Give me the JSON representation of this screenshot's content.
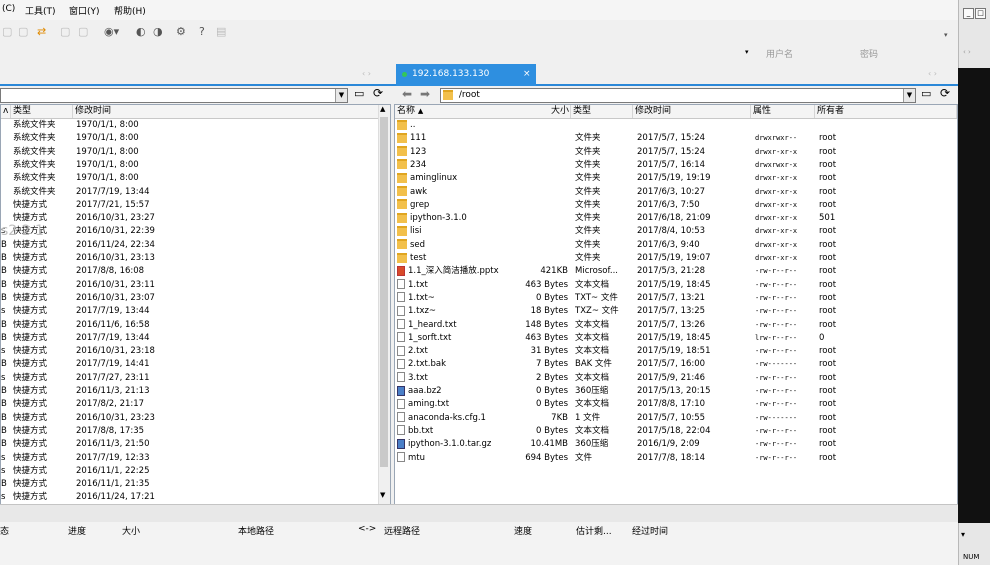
{
  "menu": {
    "items": [
      "(C)",
      "工具(T)",
      "窗口(Y)",
      "帮助(H)"
    ]
  },
  "toolbar": {
    "icons": [
      "new-session-icon",
      "transfer-icon",
      "globe-icon",
      "gear-icon",
      "help-icon"
    ]
  },
  "connect": {
    "username_placeholder": "用户名",
    "password_placeholder": "密码"
  },
  "remote_tab": {
    "title": "192.168.133.130",
    "close": "×",
    "status_color": "#34c759"
  },
  "remote_path": "/root",
  "local_pane": {
    "columns": [
      "类型",
      "修改时间"
    ],
    "rows": [
      {
        "pre": "",
        "type": "系统文件夹",
        "date": "1970/1/1, 8:00"
      },
      {
        "pre": "",
        "type": "系统文件夹",
        "date": "1970/1/1, 8:00"
      },
      {
        "pre": "",
        "type": "系统文件夹",
        "date": "1970/1/1, 8:00"
      },
      {
        "pre": "",
        "type": "系统文件夹",
        "date": "1970/1/1, 8:00"
      },
      {
        "pre": "",
        "type": "系统文件夹",
        "date": "1970/1/1, 8:00"
      },
      {
        "pre": "",
        "type": "系统文件夹",
        "date": "2017/7/19, 13:44"
      },
      {
        "pre": "",
        "type": "快捷方式",
        "date": "2017/7/21, 15:57"
      },
      {
        "pre": "",
        "type": "快捷方式",
        "date": "2016/10/31, 23:27"
      },
      {
        "pre": "s",
        "type": "快捷方式",
        "date": "2016/10/31, 22:39"
      },
      {
        "pre": "B",
        "type": "快捷方式",
        "date": "2016/11/24, 22:34"
      },
      {
        "pre": "B",
        "type": "快捷方式",
        "date": "2016/10/31, 23:13"
      },
      {
        "pre": "B",
        "type": "快捷方式",
        "date": "2017/8/8, 16:08"
      },
      {
        "pre": "B",
        "type": "快捷方式",
        "date": "2016/10/31, 23:11"
      },
      {
        "pre": "B",
        "type": "快捷方式",
        "date": "2016/10/31, 23:07"
      },
      {
        "pre": "s",
        "type": "快捷方式",
        "date": "2017/7/19, 13:44"
      },
      {
        "pre": "B",
        "type": "快捷方式",
        "date": "2016/11/6, 16:58"
      },
      {
        "pre": "B",
        "type": "快捷方式",
        "date": "2017/7/19, 13:44"
      },
      {
        "pre": "s",
        "type": "快捷方式",
        "date": "2016/10/31, 23:18"
      },
      {
        "pre": "B",
        "type": "快捷方式",
        "date": "2017/7/19, 14:41"
      },
      {
        "pre": "s",
        "type": "快捷方式",
        "date": "2017/7/27, 23:11"
      },
      {
        "pre": "B",
        "type": "快捷方式",
        "date": "2016/11/3, 21:13"
      },
      {
        "pre": "B",
        "type": "快捷方式",
        "date": "2017/8/2, 21:17"
      },
      {
        "pre": "B",
        "type": "快捷方式",
        "date": "2016/10/31, 23:23"
      },
      {
        "pre": "B",
        "type": "快捷方式",
        "date": "2017/8/8, 17:35"
      },
      {
        "pre": "B",
        "type": "快捷方式",
        "date": "2016/11/3, 21:50"
      },
      {
        "pre": "s",
        "type": "快捷方式",
        "date": "2017/7/19, 12:33"
      },
      {
        "pre": "s",
        "type": "快捷方式",
        "date": "2016/11/1, 22:25"
      },
      {
        "pre": "B",
        "type": "快捷方式",
        "date": "2016/11/1, 21:35"
      },
      {
        "pre": "s",
        "type": "快捷方式",
        "date": "2016/11/24, 17:21"
      }
    ]
  },
  "remote_pane": {
    "columns": [
      "名称",
      "大小",
      "类型",
      "修改时间",
      "属性",
      "所有者"
    ],
    "rows": [
      {
        "icon": "folder",
        "name": "..",
        "size": "",
        "type": "",
        "date": "",
        "attr": "",
        "owner": ""
      },
      {
        "icon": "folder",
        "name": "111",
        "size": "",
        "type": "文件夹",
        "date": "2017/5/7, 15:24",
        "attr": "drwxrwxr--",
        "owner": "root"
      },
      {
        "icon": "folder",
        "name": "123",
        "size": "",
        "type": "文件夹",
        "date": "2017/5/7, 15:24",
        "attr": "drwxr-xr-x",
        "owner": "root"
      },
      {
        "icon": "folder",
        "name": "234",
        "size": "",
        "type": "文件夹",
        "date": "2017/5/7, 16:14",
        "attr": "drwxrwxr-x",
        "owner": "root"
      },
      {
        "icon": "folder",
        "name": "aminglinux",
        "size": "",
        "type": "文件夹",
        "date": "2017/5/19, 19:19",
        "attr": "drwxr-xr-x",
        "owner": "root"
      },
      {
        "icon": "folder",
        "name": "awk",
        "size": "",
        "type": "文件夹",
        "date": "2017/6/3, 10:27",
        "attr": "drwxr-xr-x",
        "owner": "root"
      },
      {
        "icon": "folder",
        "name": "grep",
        "size": "",
        "type": "文件夹",
        "date": "2017/6/3, 7:50",
        "attr": "drwxr-xr-x",
        "owner": "root"
      },
      {
        "icon": "folder",
        "name": "ipython-3.1.0",
        "size": "",
        "type": "文件夹",
        "date": "2017/6/18, 21:09",
        "attr": "drwxr-xr-x",
        "owner": "501"
      },
      {
        "icon": "folder",
        "name": "lisi",
        "size": "",
        "type": "文件夹",
        "date": "2017/8/4, 10:53",
        "attr": "drwxr-xr-x",
        "owner": "root"
      },
      {
        "icon": "folder",
        "name": "sed",
        "size": "",
        "type": "文件夹",
        "date": "2017/6/3, 9:40",
        "attr": "drwxr-xr-x",
        "owner": "root"
      },
      {
        "icon": "folder",
        "name": "test",
        "size": "",
        "type": "文件夹",
        "date": "2017/5/19, 19:07",
        "attr": "drwxr-xr-x",
        "owner": "root"
      },
      {
        "icon": "pptx",
        "name": "1.1_深入简洁播放.pptx",
        "size": "421KB",
        "type": "Microsof...",
        "date": "2017/5/3, 21:28",
        "attr": "-rw-r--r--",
        "owner": "root"
      },
      {
        "icon": "file",
        "name": "1.txt",
        "size": "463 Bytes",
        "type": "文本文档",
        "date": "2017/5/19, 18:45",
        "attr": "-rw-r--r--",
        "owner": "root"
      },
      {
        "icon": "file",
        "name": "1.txt~",
        "size": "0 Bytes",
        "type": "TXT~ 文件",
        "date": "2017/5/7, 13:21",
        "attr": "-rw-r--r--",
        "owner": "root"
      },
      {
        "icon": "file",
        "name": "1.txz~",
        "size": "18 Bytes",
        "type": "TXZ~ 文件",
        "date": "2017/5/7, 13:25",
        "attr": "-rw-r--r--",
        "owner": "root"
      },
      {
        "icon": "file",
        "name": "1_heard.txt",
        "size": "148 Bytes",
        "type": "文本文档",
        "date": "2017/5/7, 13:26",
        "attr": "-rw-r--r--",
        "owner": "root"
      },
      {
        "icon": "file",
        "name": "1_sorft.txt",
        "size": "463 Bytes",
        "type": "文本文档",
        "date": "2017/5/19, 18:45",
        "attr": "lrw-r--r--",
        "owner": "0"
      },
      {
        "icon": "file",
        "name": "2.txt",
        "size": "31 Bytes",
        "type": "文本文档",
        "date": "2017/5/19, 18:51",
        "attr": "-rw-r--r--",
        "owner": "root"
      },
      {
        "icon": "file",
        "name": "2.txt.bak",
        "size": "7 Bytes",
        "type": "BAK 文件",
        "date": "2017/5/7, 16:00",
        "attr": "-rw-------",
        "owner": "root"
      },
      {
        "icon": "file",
        "name": "3.txt",
        "size": "2 Bytes",
        "type": "文本文档",
        "date": "2017/5/9, 21:46",
        "attr": "-rw-r--r--",
        "owner": "root"
      },
      {
        "icon": "zip",
        "name": "aaa.bz2",
        "size": "0 Bytes",
        "type": "360压缩",
        "date": "2017/5/13, 20:15",
        "attr": "-rw-r--r--",
        "owner": "root"
      },
      {
        "icon": "file",
        "name": "aming.txt",
        "size": "0 Bytes",
        "type": "文本文档",
        "date": "2017/8/8, 17:10",
        "attr": "-rw-r--r--",
        "owner": "root"
      },
      {
        "icon": "file",
        "name": "anaconda-ks.cfg.1",
        "size": "7KB",
        "type": "1 文件",
        "date": "2017/5/7, 10:55",
        "attr": "-rw-------",
        "owner": "root"
      },
      {
        "icon": "file",
        "name": "bb.txt",
        "size": "0 Bytes",
        "type": "文本文档",
        "date": "2017/5/18, 22:04",
        "attr": "-rw-r--r--",
        "owner": "root"
      },
      {
        "icon": "zip",
        "name": "ipython-3.1.0.tar.gz",
        "size": "10.41MB",
        "type": "360压缩",
        "date": "2016/1/9, 2:09",
        "attr": "-rw-r--r--",
        "owner": "root"
      },
      {
        "icon": "file",
        "name": "mtu",
        "size": "694 Bytes",
        "type": "文件",
        "date": "2017/7/8, 18:14",
        "attr": "-rw-r--r--",
        "owner": "root"
      }
    ]
  },
  "transfer": {
    "columns": [
      "态",
      "进度",
      "大小",
      "本地路径",
      "<->",
      "远程路径",
      "速度",
      "估计剩...",
      "经过时间"
    ]
  },
  "status": {
    "num": "NUM"
  },
  "watermark": "s2 2 1"
}
